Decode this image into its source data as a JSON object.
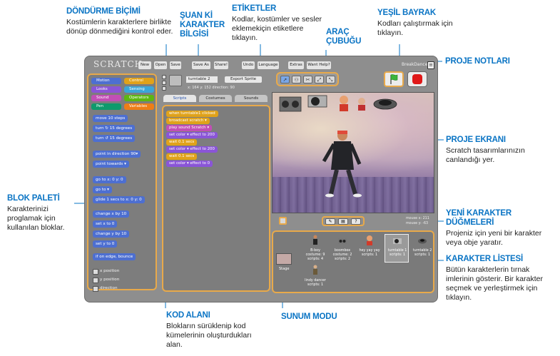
{
  "callouts": {
    "costume_rotation": {
      "title": "DÖNDÜRME BİÇİMİ",
      "desc": "Kostümlerin karakterlere birlikte dönüp dönmediğini kontrol eder."
    },
    "sprite_info": {
      "title": "ŞUAN Kİ KARAKTER BİLGİSİ",
      "desc": ""
    },
    "tabs": {
      "title": "ETİKETLER",
      "desc": "Kodlar, kostümler ve sesler eklemekiçin etiketlere tıklayın."
    },
    "toolbar": {
      "title": "ARAÇ ÇUBUĞU",
      "desc": ""
    },
    "green_flag": {
      "title": "YEŞİL BAYRAK",
      "desc": "Kodları çalıştırmak için tıklayın."
    },
    "project_notes": {
      "title": "PROJE NOTLARI",
      "desc": ""
    },
    "stage": {
      "title": "PROJE EKRANI",
      "desc": "Scratch tasarımlarınızın canlandığı yer."
    },
    "new_sprite": {
      "title": "YENİ KARAKTER DÜĞMELERİ",
      "desc": "Projeniz için yeni bir karakter veya obje yaratır."
    },
    "sprite_list": {
      "title": "KARAKTER LİSTESİ",
      "desc": "Bütün karakterlerin tırnak imlerinin gösterir. Bir karakter seçmek ve yerleştirmek için tıklayın."
    },
    "block_palette": {
      "title": "BLOK PALETİ",
      "desc": "Karakterinizi proglamak için kullanılan bloklar."
    },
    "script_area": {
      "title": "KOD ALANI",
      "desc": "Blokların sürüklenip kod kümelerinin oluşturdukları alan."
    },
    "presentation": {
      "title": "SUNUM MODU",
      "desc": ""
    }
  },
  "scratch": {
    "logo": "SCRATCH",
    "menu": [
      "New",
      "Open",
      "Save",
      "Save As",
      "Share!",
      "Undo",
      "Language",
      "Extras",
      "Want Help?"
    ],
    "project_name": "BreakDance",
    "categories": [
      "Motion",
      "Control",
      "Looks",
      "Sensing",
      "Sound",
      "Operators",
      "Pen",
      "Variables"
    ],
    "palette_blocks": [
      "move 10 steps",
      "turn ↻ 15 degrees",
      "turn ↺ 15 degrees",
      "point in direction 90▾",
      "point towards ▾",
      "go to x: 0 y: 0",
      "go to ▾",
      "glide 1 secs to x: 0 y: 0",
      "change x by 10",
      "set x to 0",
      "change y by 10",
      "set y to 0",
      "if on edge, bounce"
    ],
    "palette_checks": [
      "x position",
      "y position",
      "direction"
    ],
    "sprite_name": "turntable 2",
    "export_label": "Export Sprite",
    "coords": "x: 164  y: 152  direction: 90",
    "tabs": [
      "Scripts",
      "Costumes",
      "Sounds"
    ],
    "script_blocks": [
      "when turntable1 clicked",
      "broadcast scratch ▾",
      "play sound Scratch ▾",
      "set color ▾ effect to 200",
      "wait 0.1 secs",
      "set color ▾ effect to 200",
      "wait 0.1 secs",
      "set color ▾ effect to 0"
    ],
    "mouse_x": "mouse x: 211",
    "mouse_y": "mouse y: -63",
    "stage_label": "Stage",
    "sprites": [
      {
        "name": "B-boy",
        "info": "costume: 9 scripts: 4"
      },
      {
        "name": "boombox",
        "info": "costume: 2 scripts: 2"
      },
      {
        "name": "hey yay yay",
        "info": "scripts: 1"
      },
      {
        "name": "turntable 1",
        "info": "scripts: 1"
      },
      {
        "name": "turntable 2",
        "info": "scripts: 1"
      },
      {
        "name": "lindy dancer",
        "info": "scripts: 1"
      }
    ]
  },
  "colors": {
    "accent": "#0a74c4",
    "highlight": "#e8a94a",
    "motion": "#4d6fd1",
    "control": "#e0a21a",
    "looks": "#8a55d7"
  }
}
